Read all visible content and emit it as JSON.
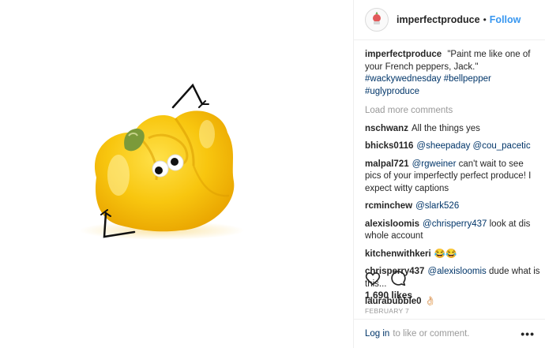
{
  "header": {
    "username": "imperfectproduce",
    "separator": "•",
    "follow_label": "Follow"
  },
  "caption": {
    "username": "imperfectproduce",
    "text": "\"Paint me like one of your French peppers, Jack.\"",
    "hashtags": "#wackywednesday #bellpepper",
    "hashtags2": "#uglyproduce"
  },
  "load_more_label": "Load more comments",
  "comments": [
    {
      "user": "nschwanz",
      "text": "All the things yes"
    },
    {
      "user": "bhicks0116",
      "mention1": "@sheepaday",
      "mention2": "@cou_pacetic"
    },
    {
      "user": "malpal721",
      "mention": "@rgweiner",
      "text": "can't wait to see pics of your imperfectly perfect produce! I expect witty captions"
    },
    {
      "user": "rcminchew",
      "mention": "@slark526"
    },
    {
      "user": "alexisloomis",
      "mention": "@chrisperry437",
      "text": "look at dis whole account"
    },
    {
      "user": "kitchenwithkeri",
      "text": "😂😂"
    },
    {
      "user": "chrisperry437",
      "mention": "@alexisloomis",
      "text": "dude what is this..."
    },
    {
      "user": "laurabubble0",
      "text": "👌🏻"
    }
  ],
  "likes": "1,690 likes",
  "date": "FEBRUARY 7",
  "footer": {
    "login_label": "Log in",
    "rest": "to like or comment.",
    "more": "•••"
  },
  "icons": {
    "like": "heart-icon",
    "comment": "comment-bubble-icon",
    "more": "more-options-icon"
  },
  "colors": {
    "link_blue": "#3897f0",
    "tag_blue": "#003569",
    "muted": "#999999",
    "pepper_yellow": "#f7c30a"
  }
}
